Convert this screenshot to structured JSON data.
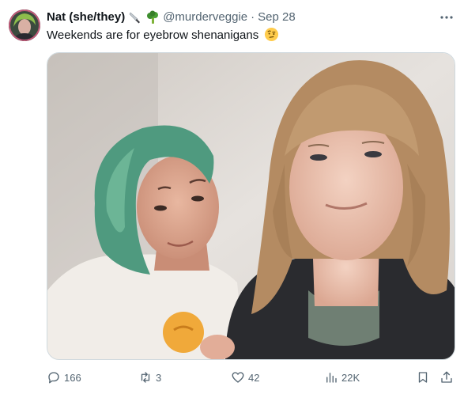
{
  "tweet": {
    "display_name": "Nat (she/they)",
    "name_emojis": [
      "knife-emoji",
      "broccoli-emoji"
    ],
    "handle": "@murderveggie",
    "separator": "·",
    "timestamp": "Sep 28",
    "text": "Weekends are for eyebrow shenanigans",
    "text_emoji": "face-with-raised-eyebrow-emoji",
    "media": {
      "subject": "selfie-photo"
    }
  },
  "actions": {
    "replies": "166",
    "retweets": "3",
    "likes": "42",
    "views": "22K"
  },
  "colors": {
    "text_primary": "#0f1419",
    "text_secondary": "#536471",
    "border": "#cfd9de"
  }
}
